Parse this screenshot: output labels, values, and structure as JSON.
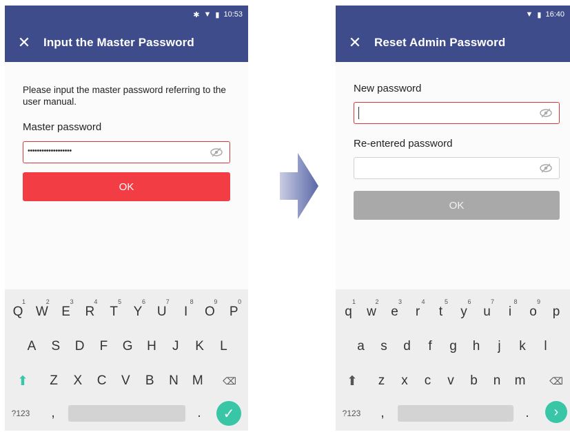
{
  "screens": [
    {
      "status": {
        "bluetooth_icon": "bluetooth-icon",
        "wifi_icon": "wifi-icon",
        "battery_icon": "battery-icon",
        "time": "10:53"
      },
      "appbar": {
        "title": "Input the Master Password"
      },
      "description": "Please input the master password referring to the user manual.",
      "field1": {
        "label": "Master password",
        "value": "•••••••••••••••••••"
      },
      "button": {
        "label": "OK",
        "color": "#f23d45"
      },
      "keyboard": {
        "row1": [
          {
            "key": "Q",
            "hint": "1"
          },
          {
            "key": "W",
            "hint": "2"
          },
          {
            "key": "E",
            "hint": "3"
          },
          {
            "key": "R",
            "hint": "4"
          },
          {
            "key": "T",
            "hint": "5"
          },
          {
            "key": "Y",
            "hint": "6"
          },
          {
            "key": "U",
            "hint": "7"
          },
          {
            "key": "I",
            "hint": "8"
          },
          {
            "key": "O",
            "hint": "9"
          },
          {
            "key": "P",
            "hint": "0"
          }
        ],
        "row2": [
          "A",
          "S",
          "D",
          "F",
          "G",
          "H",
          "J",
          "K",
          "L"
        ],
        "row3": [
          "Z",
          "X",
          "C",
          "V",
          "B",
          "N",
          "M"
        ],
        "symbols": "?123",
        "comma": ",",
        "period": "."
      }
    },
    {
      "status": {
        "wifi_icon": "wifi-icon",
        "battery_icon": "battery-icon",
        "time": "16:40"
      },
      "appbar": {
        "title": "Reset Admin Password"
      },
      "field1": {
        "label": "New password",
        "value": ""
      },
      "field2": {
        "label": "Re-entered password",
        "value": ""
      },
      "button": {
        "label": "OK",
        "color": "#a9a9a9"
      },
      "keyboard": {
        "row1": [
          {
            "key": "q",
            "hint": "1"
          },
          {
            "key": "w",
            "hint": "2"
          },
          {
            "key": "e",
            "hint": "3"
          },
          {
            "key": "r",
            "hint": "4"
          },
          {
            "key": "t",
            "hint": "5"
          },
          {
            "key": "y",
            "hint": "6"
          },
          {
            "key": "u",
            "hint": "7"
          },
          {
            "key": "i",
            "hint": "8"
          },
          {
            "key": "o",
            "hint": "9"
          },
          {
            "key": "p",
            "hint": ""
          }
        ],
        "row2": [
          "a",
          "s",
          "d",
          "f",
          "g",
          "h",
          "j",
          "k",
          "l"
        ],
        "row3": [
          "z",
          "x",
          "c",
          "v",
          "b",
          "n",
          "m"
        ],
        "symbols": "?123",
        "comma": ",",
        "period": "."
      }
    }
  ],
  "theme": {
    "appbar": "#3e4c8b",
    "accent_red": "#f23d45",
    "enter_green": "#38c6a7"
  },
  "transition_icon": "right-arrow-icon"
}
